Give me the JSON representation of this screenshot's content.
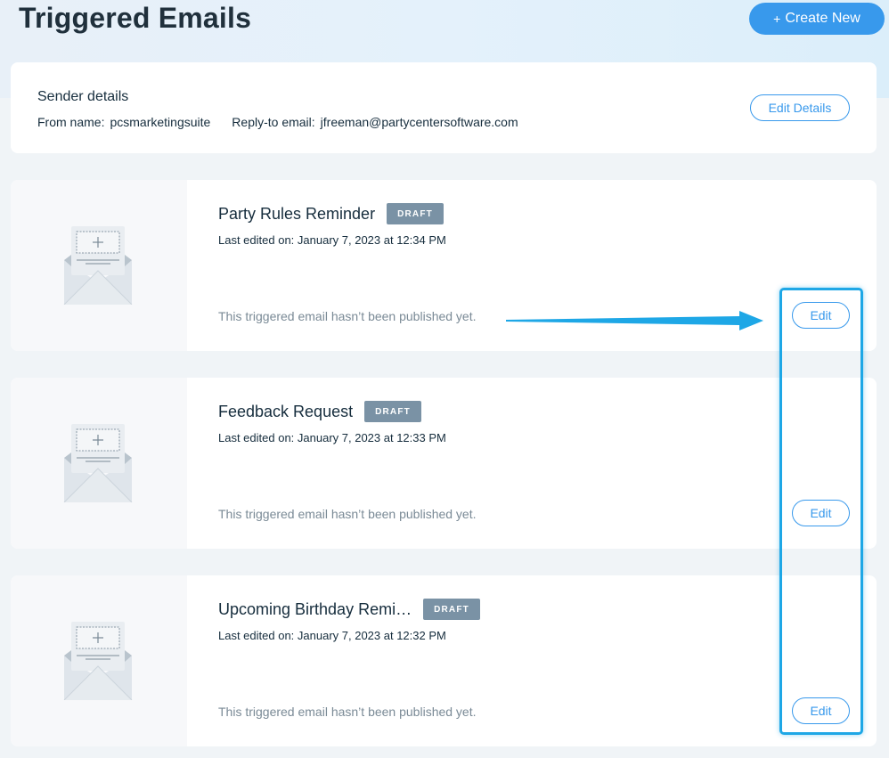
{
  "header": {
    "title": "Triggered Emails",
    "create_button": {
      "icon": "plus-icon",
      "label": "Create New"
    }
  },
  "sender": {
    "title": "Sender details",
    "from_name_label": "From name:",
    "from_name_value": "pcsmarketingsuite",
    "reply_to_label": "Reply-to email:",
    "reply_to_value": "jfreeman@partycentersoftware.com",
    "edit_button": "Edit Details"
  },
  "emails": [
    {
      "title": "Party Rules Reminder",
      "status": "DRAFT",
      "last_edited": "Last edited on: January 7, 2023 at 12:34 PM",
      "note": "This triggered email hasn’t been published yet.",
      "edit_label": "Edit"
    },
    {
      "title": "Feedback Request",
      "status": "DRAFT",
      "last_edited": "Last edited on: January 7, 2023 at 12:33 PM",
      "note": "This triggered email hasn’t been published yet.",
      "edit_label": "Edit"
    },
    {
      "title": "Upcoming Birthday Remi…",
      "status": "DRAFT",
      "last_edited": "Last edited on: January 7, 2023 at 12:32 PM",
      "note": "This triggered email hasn’t been published yet.",
      "edit_label": "Edit"
    }
  ],
  "annotation": {
    "arrow_color": "#1ea7e6",
    "highlight_color": "#1ea7e6"
  },
  "colors": {
    "accent": "#3899ec",
    "badge": "#7a92a5",
    "text": "#162d3d"
  }
}
